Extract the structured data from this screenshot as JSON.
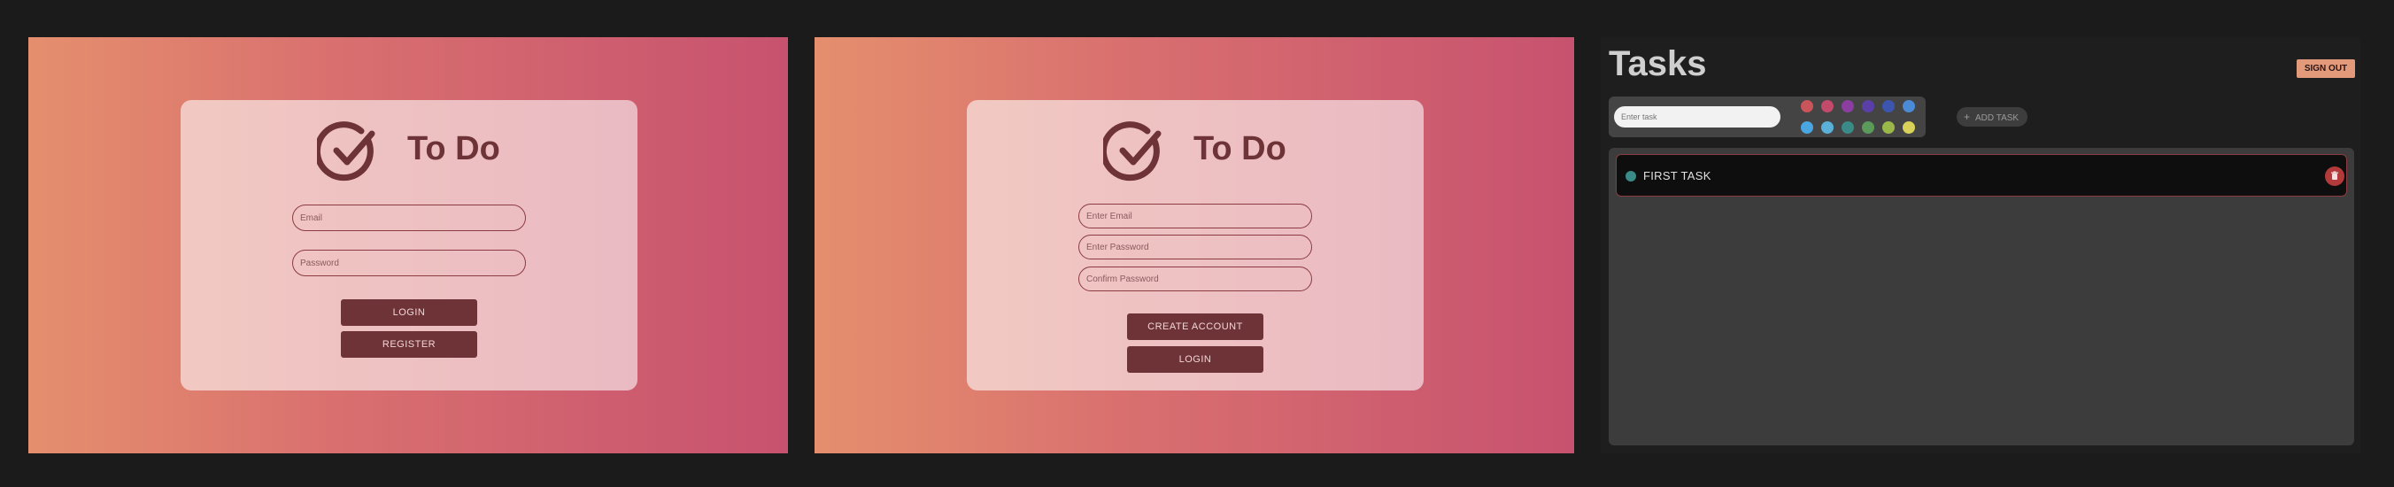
{
  "login_screen": {
    "brand_title": "To Do",
    "email_placeholder": "Email",
    "password_placeholder": "Password",
    "login_button": "LOGIN",
    "register_button": "REGISTER"
  },
  "register_screen": {
    "brand_title": "To Do",
    "email_placeholder": "Enter Email",
    "password_placeholder": "Enter Password",
    "confirm_placeholder": "Confirm Password",
    "create_button": "CREATE ACCOUNT",
    "login_button": "LOGIN"
  },
  "tasks_screen": {
    "title": "Tasks",
    "sign_out": "SIGN OUT",
    "task_placeholder": "Enter task",
    "add_task": "ADD TASK",
    "colors": [
      "#c9545a",
      "#c24a6a",
      "#8a3fa0",
      "#5a3fa8",
      "#3c56b0",
      "#4a8ad6",
      "#4aa6e0",
      "#5ab0d8",
      "#3a8a88",
      "#5a9a5a",
      "#9ab84a",
      "#d8d25a"
    ],
    "tasks": [
      {
        "label": "FIRST TASK",
        "color": "#3a8a88"
      }
    ]
  },
  "theme": {
    "accent": "#6e3336",
    "signout_color": "#e39a7a",
    "delete_color": "#b23a3a"
  }
}
